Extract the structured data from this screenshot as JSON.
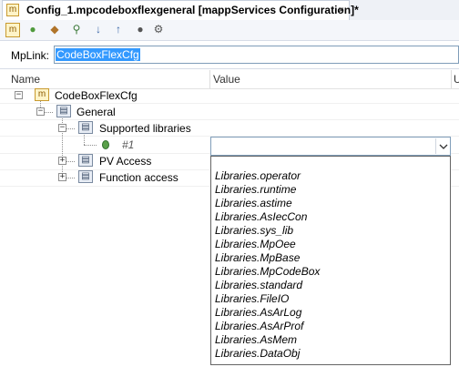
{
  "tab": {
    "icon": "m",
    "title": "Config_1.mpcodeboxflexgeneral [mappServices Configuration]*",
    "close": "×"
  },
  "toolbar": {
    "buttons": [
      {
        "icon": "new-item-icon",
        "glyph": "m"
      },
      {
        "icon": "add-icon",
        "glyph": "●"
      },
      {
        "icon": "move-icon",
        "glyph": "◆"
      },
      {
        "icon": "link-icon",
        "glyph": "⚲"
      },
      {
        "icon": "sort-down-icon",
        "glyph": "↓"
      },
      {
        "icon": "sort-up-icon",
        "glyph": "↑"
      },
      {
        "icon": "record-icon",
        "glyph": "●"
      },
      {
        "icon": "settings-icon",
        "glyph": "⚙"
      }
    ]
  },
  "mplink": {
    "label": "MpLink:",
    "value": "CodeBoxFlexCfg"
  },
  "columns": {
    "name": "Name",
    "value": "Value",
    "unit": "U"
  },
  "tree": {
    "root": "CodeBoxFlexCfg",
    "general": "General",
    "supported_libraries": "Supported libraries",
    "item": "#1",
    "pv_access": "PV Access",
    "function_access": "Function access",
    "collapse": "−",
    "expand": "+"
  },
  "combo": {
    "value": "",
    "arrow": "⌄"
  },
  "dropdown": {
    "items": [
      "Libraries.operator",
      "Libraries.runtime",
      "Libraries.astime",
      "Libraries.AsIecCon",
      "Libraries.sys_lib",
      "Libraries.MpOee",
      "Libraries.MpBase",
      "Libraries.MpCodeBox",
      "Libraries.standard",
      "Libraries.FileIO",
      "Libraries.AsArLog",
      "Libraries.AsArProf",
      "Libraries.AsMem",
      "Libraries.DataObj"
    ]
  }
}
